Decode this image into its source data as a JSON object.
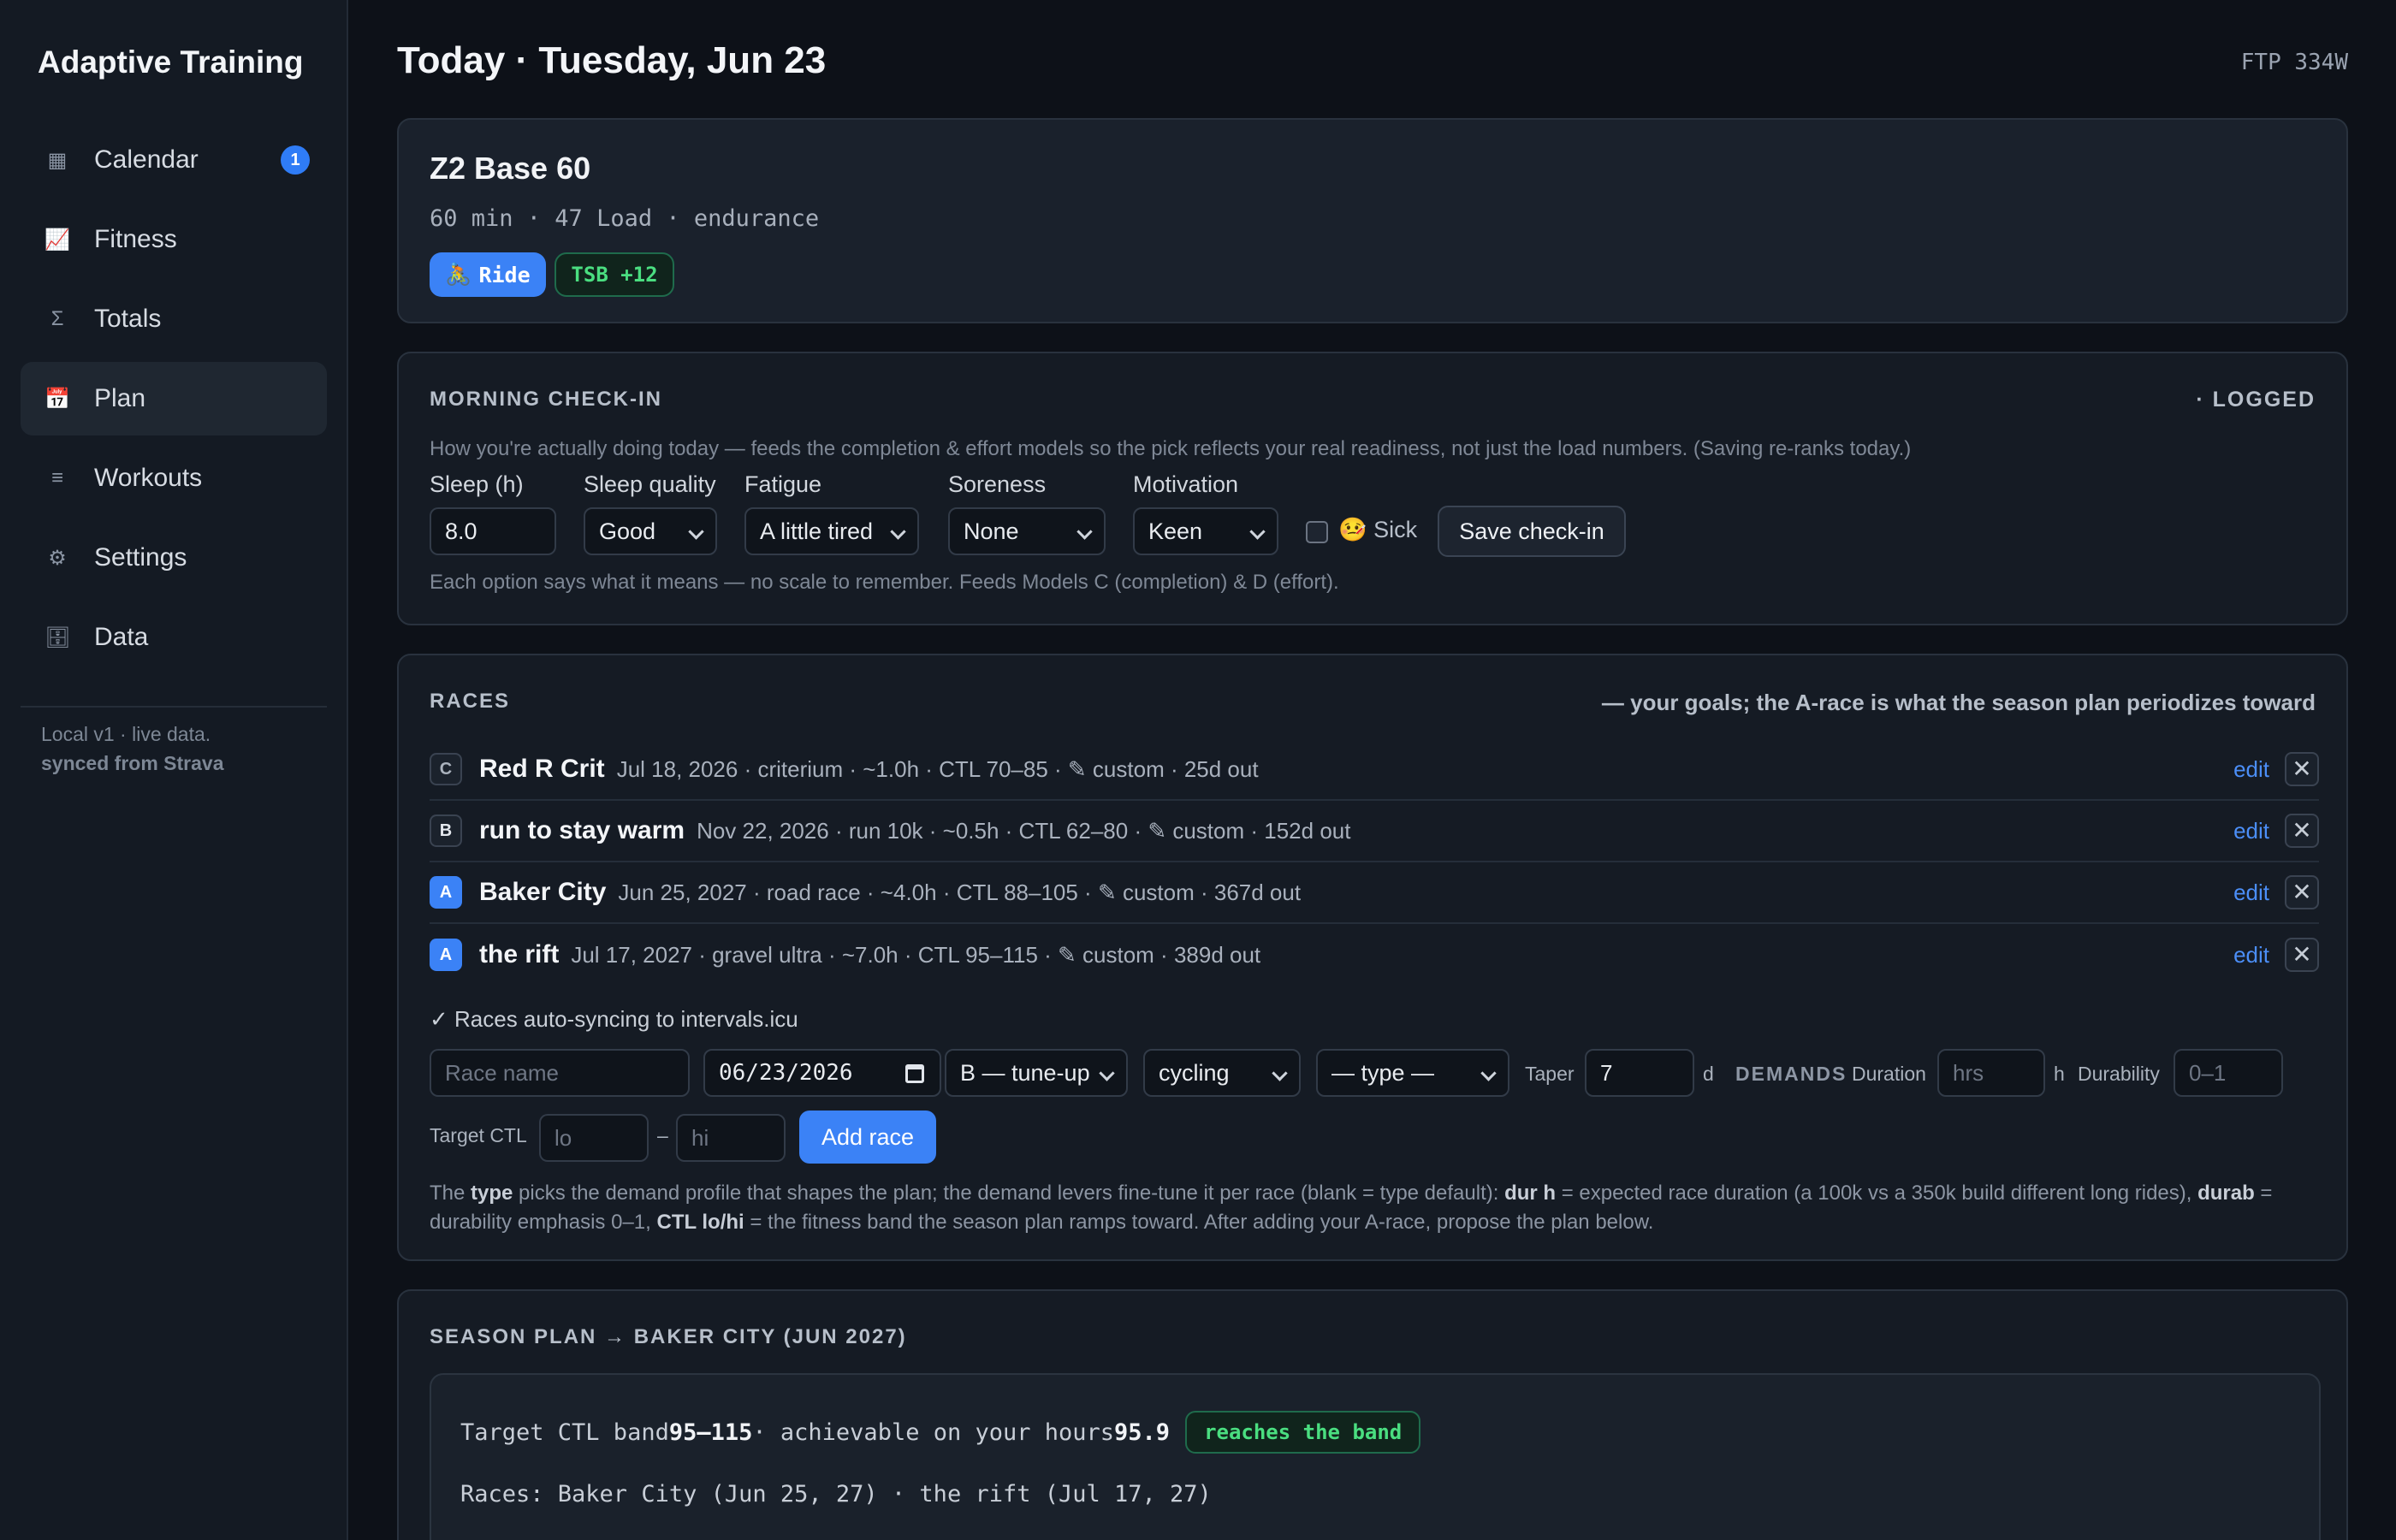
{
  "sidebar": {
    "brand": "Adaptive Training",
    "items": [
      {
        "label": "Calendar",
        "icon": "▦",
        "badge": "1"
      },
      {
        "label": "Fitness",
        "icon": "📈"
      },
      {
        "label": "Totals",
        "icon": "Σ"
      },
      {
        "label": "Plan",
        "icon": "📅",
        "active": true
      },
      {
        "label": "Workouts",
        "icon": "≡"
      },
      {
        "label": "Settings",
        "icon": "⚙"
      },
      {
        "label": "Data",
        "icon": "🗄"
      }
    ],
    "footer_line1": "Local v1 · live data.",
    "footer_line2": "synced from Strava"
  },
  "header": {
    "title": "Today · Tuesday, Jun 23",
    "ftp": "FTP 334W"
  },
  "today": {
    "title": "Z2 Base 60",
    "meta": "60 min · 47 Load · endurance",
    "ride_icon": "🚴",
    "ride_label": "Ride",
    "tsb_label": "TSB +12"
  },
  "checkin": {
    "heading": "MORNING CHECK-IN",
    "status": "· LOGGED",
    "description": "How you're actually doing today — feeds the completion & effort models so the pick reflects your real readiness, not just the load numbers. (Saving re-ranks today.)",
    "fields": {
      "sleep_label": "Sleep (h)",
      "sleep_value": "8.0",
      "quality_label": "Sleep quality",
      "quality_value": "Good",
      "fatigue_label": "Fatigue",
      "fatigue_value": "A little tired",
      "soreness_label": "Soreness",
      "soreness_value": "None",
      "motivation_label": "Motivation",
      "motivation_value": "Keen"
    },
    "sick_label": "🤒 Sick",
    "save_label": "Save check-in",
    "footnote": "Each option says what it means — no scale to remember. Feeds Models C (completion) & D (effort)."
  },
  "races": {
    "heading": "RACES",
    "subheading": "— your goals; the A-race is what the season plan periodizes toward",
    "edit_label": "edit",
    "delete_glyph": "✕",
    "items": [
      {
        "priority": "C",
        "name": "Red R Crit",
        "detail": "Jul 18, 2026 · criterium · ~1.0h · CTL 70–85 · ✎ custom · 25d out"
      },
      {
        "priority": "B",
        "name": "run to stay warm",
        "detail": "Nov 22, 2026 · run 10k · ~0.5h · CTL 62–80 · ✎ custom · 152d out"
      },
      {
        "priority": "A",
        "name": "Baker City",
        "detail": "Jun 25, 2027 · road race · ~4.0h · CTL 88–105 · ✎ custom · 367d out"
      },
      {
        "priority": "A",
        "name": "the rift",
        "detail": "Jul 17, 2027 · gravel ultra · ~7.0h · CTL 95–115 · ✎ custom · 389d out"
      }
    ],
    "sync_note": "✓ Races auto-syncing to intervals.icu",
    "form": {
      "name_placeholder": "Race name",
      "date_value": "06/23/2026",
      "priority_value": "B — tune-up",
      "sport_value": "cycling",
      "type_value": "— type —",
      "taper_label": "Taper",
      "taper_value": "7",
      "taper_unit": "d",
      "demands_label": "DEMANDS",
      "duration_label": "Duration",
      "duration_placeholder": "hrs",
      "duration_unit": "h",
      "durability_label": "Durability",
      "durability_placeholder": "0–1",
      "target_label": "Target CTL",
      "lo_placeholder": "lo",
      "dash": "–",
      "hi_placeholder": "hi",
      "add_label": "Add race"
    },
    "explain": {
      "p1": "The ",
      "b1": "type",
      "p2": " picks the demand profile that shapes the plan; the demand levers fine-tune it per race (blank = type default): ",
      "b2": "dur h",
      "p3": " = expected race duration (a 100k vs a 350k build different long rides), ",
      "b3": "durab",
      "p4": " = durability emphasis 0–1, ",
      "b4": "CTL lo/hi",
      "p5": " = the fitness band the season plan ramps toward. After adding your A-race, propose the plan below."
    }
  },
  "season": {
    "heading": "SEASON PLAN → BAKER CITY (JUN 2027)",
    "line1_a": "Target CTL band ",
    "line1_band": "95–115",
    "line1_b": " · achievable on your hours ",
    "line1_value": "95.9",
    "pill": "reaches the band",
    "line2": "Races: Baker City (Jun 25, 27) · the rift (Jul 17, 27)"
  }
}
